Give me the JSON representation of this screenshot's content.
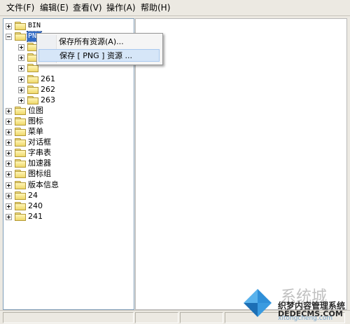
{
  "menu": {
    "file": "文件(F)",
    "edit": "编辑(E)",
    "view": "查看(V)",
    "action": "操作(A)",
    "help": "帮助(H)"
  },
  "tree": {
    "items": [
      {
        "label": "BIN",
        "expander": "plus"
      },
      {
        "label": "PNG",
        "expander": "minus",
        "selected": true
      },
      {
        "label": "",
        "expander": "plus",
        "child": true
      },
      {
        "label": "",
        "expander": "plus",
        "child": true
      },
      {
        "label": "",
        "expander": "plus",
        "child": true
      },
      {
        "label": "261",
        "expander": "plus",
        "child": true
      },
      {
        "label": "262",
        "expander": "plus",
        "child": true
      },
      {
        "label": "263",
        "expander": "plus",
        "child": true
      },
      {
        "label": "位图",
        "expander": "plus"
      },
      {
        "label": "图标",
        "expander": "plus"
      },
      {
        "label": "菜单",
        "expander": "plus"
      },
      {
        "label": "对话框",
        "expander": "plus"
      },
      {
        "label": "字串表",
        "expander": "plus"
      },
      {
        "label": "加速器",
        "expander": "plus"
      },
      {
        "label": "图标组",
        "expander": "plus"
      },
      {
        "label": "版本信息",
        "expander": "plus"
      },
      {
        "label": "24",
        "expander": "plus"
      },
      {
        "label": "240",
        "expander": "plus"
      },
      {
        "label": "241",
        "expander": "plus"
      }
    ]
  },
  "context_menu": {
    "save_all": "保存所有资源(A)...",
    "save_png": "保存 [ PNG ] 资源 ..."
  },
  "watermark": {
    "brand_cn": "系统城",
    "dede": "织梦内容管理系统",
    "dede_url": "DEDECMS.COM",
    "pinyin": "xitongcheng.com"
  },
  "colors": {
    "selection": "#316ac5",
    "menu_highlight": "#d6e6f8",
    "folder": "#f6e58f"
  }
}
